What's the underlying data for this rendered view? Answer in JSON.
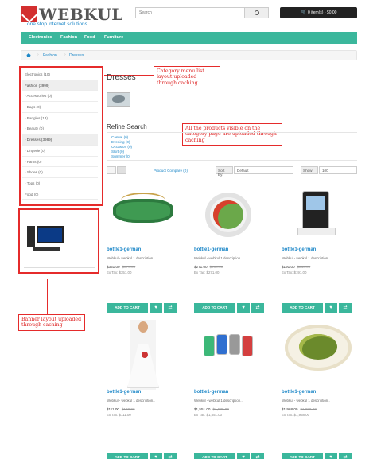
{
  "header": {
    "logo_text": "WEBKUL",
    "tagline": "one stop internet solutions",
    "search_placeholder": "Search",
    "cart_label": "0 item(s) - $0.00"
  },
  "nav": [
    "Electronics",
    "Fashion",
    "Food",
    "Furniture"
  ],
  "breadcrumb": [
    "Fashion",
    "Dresses"
  ],
  "sidebar": {
    "categories": [
      "Electronics (10)",
      "Fashion (3999)",
      "- Accessories (0)",
      "- Bags (0)",
      "- Bangles (13)",
      "- Beauty (0)",
      "- Dresses (3989)",
      "- Lingerie (0)",
      "- Pants (0)",
      "- Shoes (0)",
      "- Tops (0)",
      "Food (0)"
    ],
    "active_indices": [
      1,
      6
    ]
  },
  "callouts": {
    "menu": "Category menu list layout uploaded through caching",
    "products": "All the products visible on the category page are uploaded through caching",
    "banner": "Banner layout uploaded through caching"
  },
  "main": {
    "title": "Dresses",
    "refine_title": "Refine Search",
    "refine_options": [
      "Casual (0)",
      "Evening (0)",
      "Occasion (0)",
      "Skirt (0)",
      "Summer (0)"
    ],
    "compare_link": "Product Compare (0)",
    "sort_label": "Sort By:",
    "sort_value": "Default",
    "show_label": "Show:",
    "show_value": "100"
  },
  "products": [
    {
      "title": "bottle1-german",
      "desc": "Webkul - webkul 1 description..",
      "price": "$351.00",
      "old_price": "$370.00",
      "tax": "Ex Tax: $351.00",
      "image": "green-necklace"
    },
    {
      "title": "bottle1-german",
      "desc": "Webkul - webkul 1 description..",
      "price": "$271.00",
      "old_price": "$290.00",
      "tax": "Ex Tax: $271.00",
      "image": "salad-bowl"
    },
    {
      "title": "bottle1-german",
      "desc": "Webkul - webkul 1 description..",
      "price": "$191.00",
      "old_price": "$210.00",
      "tax": "Ex Tax: $191.00",
      "image": "ipod-dock"
    },
    {
      "title": "bottle1-german",
      "desc": "Webkul - webkul 1 description..",
      "price": "$111.00",
      "old_price": "$130.00",
      "tax": "Ex Tax: $111.00",
      "image": "wedding-dress"
    },
    {
      "title": "bottle1-german",
      "desc": "Webkul - webkul 1 description..",
      "price": "$1,551.00",
      "old_price": "$1,570.00",
      "tax": "Ex Tax: $1,551.00",
      "image": "ipod-nanos"
    },
    {
      "title": "bottle1-german",
      "desc": "Webkul - webkul 1 description..",
      "price": "$1,968.00",
      "old_price": "$1,990.00",
      "tax": "Ex Tax: $1,968.00",
      "image": "food-plate"
    }
  ],
  "buttons": {
    "add_to_cart": "ADD TO CART",
    "wishlist_icon": "♥",
    "compare_icon": "⇄"
  },
  "colors": {
    "accent": "#3bb79c",
    "link": "#1e88c8",
    "annotation": "#e52b2b"
  }
}
